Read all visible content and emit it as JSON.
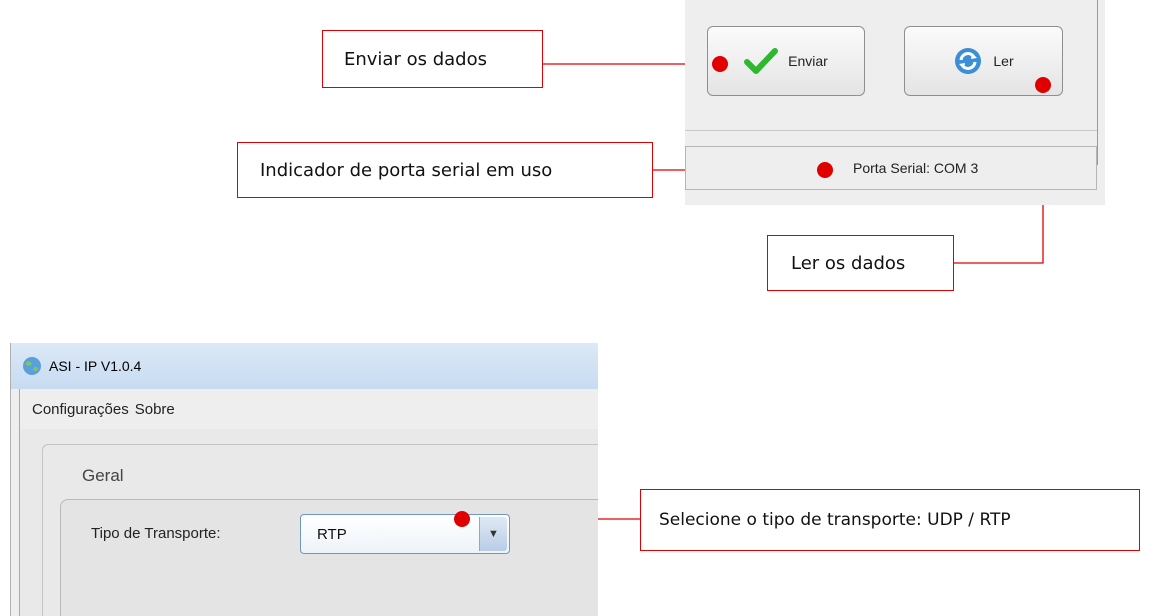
{
  "top_panel": {
    "enviar_button": "Enviar",
    "ler_button": "Ler",
    "status": "Porta Serial: COM 3"
  },
  "callouts": {
    "enviar": "Enviar os dados",
    "porta": "Indicador de porta serial em uso",
    "ler": "Ler os dados",
    "tipo": "Selecione o tipo de transporte: UDP / RTP"
  },
  "window": {
    "title": "ASI - IP V1.0.4",
    "menu": [
      "Configurações",
      "Sobre"
    ],
    "group_title": "Geral",
    "transport_label": "Tipo de Transporte:",
    "transport_value": "RTP"
  },
  "colors": {
    "callout_red": "#e00000",
    "check_green": "#2eb82e",
    "combo_border": "#6f97c6"
  },
  "icons": {
    "enviar": "checkmark-icon",
    "ler": "refresh-icon",
    "app": "globe-icon",
    "dropdown": "chevron-down-icon"
  }
}
